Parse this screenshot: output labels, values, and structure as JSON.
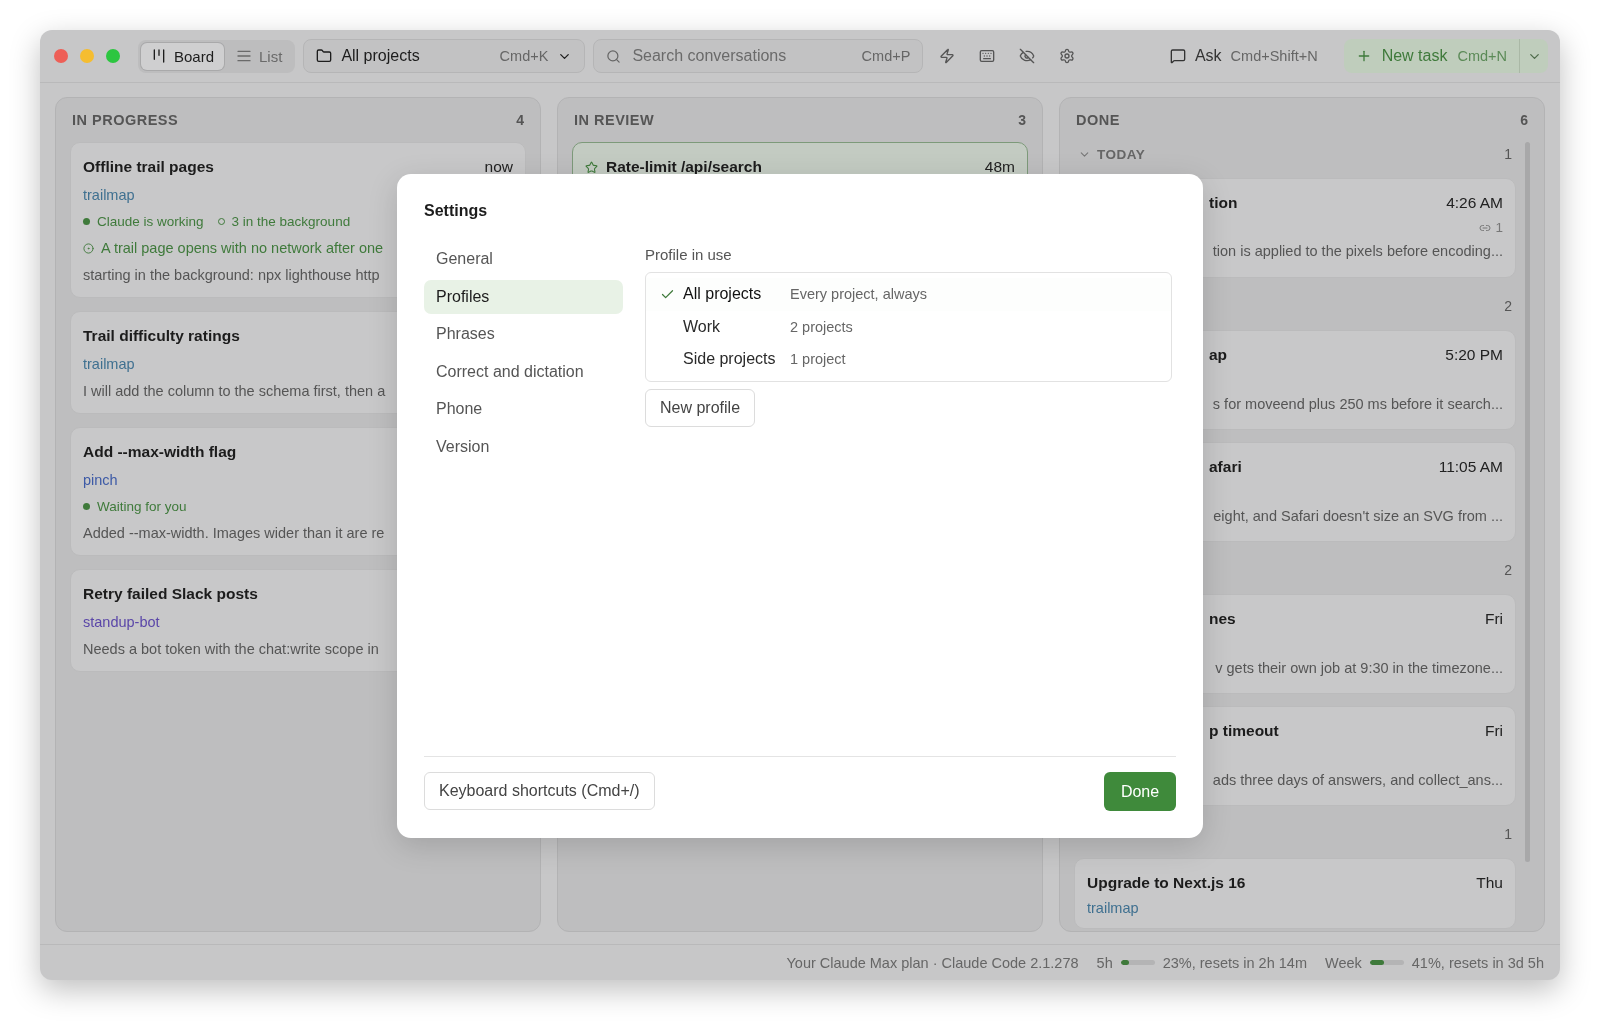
{
  "toolbar": {
    "views": [
      {
        "label": "Board",
        "kind": "board",
        "selected": true
      },
      {
        "label": "List",
        "kind": "list",
        "selected": false
      }
    ],
    "project_picker": {
      "label": "All projects",
      "shortcut": "Cmd+K"
    },
    "search": {
      "placeholder": "Search conversations",
      "shortcut": "Cmd+P"
    },
    "ask": {
      "label": "Ask",
      "shortcut": "Cmd+Shift+N"
    },
    "new_task": {
      "label": "New task",
      "shortcut": "Cmd+N"
    }
  },
  "columns": [
    {
      "title": "IN PROGRESS",
      "count": "4",
      "cards": [
        {
          "title": "Offline trail pages",
          "time": "now",
          "project": "trailmap",
          "color": "#3f7090",
          "statuses": [
            {
              "kind": "dot",
              "text": "Claude is working"
            },
            {
              "kind": "ring",
              "text": "3 in the background"
            }
          ],
          "goal": "A trail page opens with no network after one",
          "summary": "starting in the background: npx lighthouse http"
        },
        {
          "title": "Trail difficulty ratings",
          "project": "trailmap",
          "color": "#3f7090",
          "summary": "I will add the column to the schema first, then a"
        },
        {
          "title": "Add --max-width flag",
          "project": "pinch",
          "color": "#3d5aa6",
          "statuses": [
            {
              "kind": "dot",
              "text": "Waiting for you"
            }
          ],
          "summary": "Added --max-width. Images wider than it are re"
        },
        {
          "title": "Retry failed Slack posts",
          "project": "standup-bot",
          "color": "#5a46a8",
          "summary": "Needs a bot token with the chat:write scope in"
        }
      ]
    },
    {
      "title": "IN REVIEW",
      "count": "3",
      "cards": [
        {
          "title": "Rate-limit /api/search",
          "time": "48m",
          "starred": true,
          "selected": true
        }
      ]
    },
    {
      "title": "DONE",
      "count": "6",
      "groups": [
        {
          "label": "TODAY",
          "count": "1",
          "cards": [
            {
              "title": "tion",
              "time": "4:26 AM",
              "links": "1",
              "summary": "tion is applied to the pixels before encoding...",
              "covered": true
            }
          ]
        },
        {
          "count": "2",
          "cards": [
            {
              "title": "ap",
              "time": "5:20 PM",
              "summary": "s for moveend plus 250 ms before it search...",
              "covered": true
            },
            {
              "title": "afari",
              "time": "11:05 AM",
              "summary": "eight, and Safari doesn't size an SVG from ...",
              "covered": true
            }
          ]
        },
        {
          "count": "2",
          "cards": [
            {
              "title": "nes",
              "time": "Fri",
              "summary": "v gets their own job at 9:30 in the timezone...",
              "covered": true
            },
            {
              "title": "p timeout",
              "time": "Fri",
              "summary": "ads three days of answers, and collect_ans...",
              "covered": true
            }
          ]
        },
        {
          "count": "1",
          "cards": [
            {
              "title": "Upgrade to Next.js 16",
              "time": "Thu",
              "project": "trailmap",
              "color": "#3f7090",
              "covered": false
            }
          ]
        }
      ]
    }
  ],
  "status_bar": {
    "plan": "Your Claude Max plan · Claude Code 2.1.278",
    "meters": [
      {
        "label": "5h",
        "level": 0.23,
        "reading": "23%, resets in 2h 14m"
      },
      {
        "label": "Week",
        "level": 0.41,
        "reading": "41%, resets in 3d 5h"
      }
    ]
  },
  "settings": {
    "title": "Settings",
    "nav": [
      {
        "label": "General",
        "selected": false
      },
      {
        "label": "Profiles",
        "selected": true
      },
      {
        "label": "Phrases",
        "selected": false
      },
      {
        "label": "Correct and dictation",
        "selected": false
      },
      {
        "label": "Phone",
        "selected": false
      },
      {
        "label": "Version",
        "selected": false
      }
    ],
    "section_label": "Profile in use",
    "profiles": [
      {
        "name": "All projects",
        "detail": "Every project, always",
        "selected": true
      },
      {
        "name": "Work",
        "detail": "2 projects",
        "selected": false
      },
      {
        "name": "Side projects",
        "detail": "1 project",
        "selected": false
      }
    ],
    "new_profile": "New profile",
    "shortcuts": "Keyboard shortcuts (Cmd+/)",
    "done": "Done"
  }
}
